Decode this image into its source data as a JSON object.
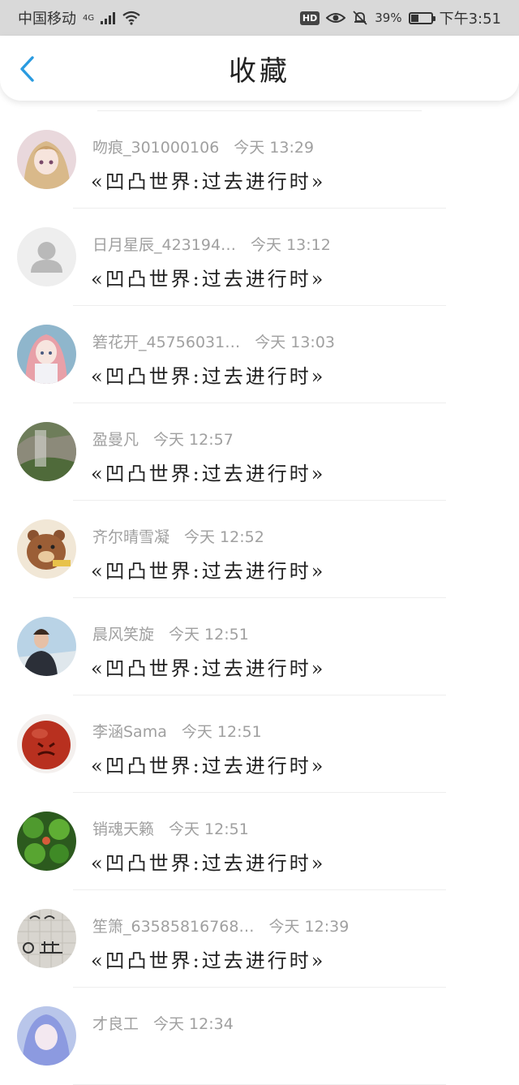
{
  "status_bar": {
    "carrier": "中国移动",
    "network": "4G",
    "hd": "HD",
    "battery_percent": "39%",
    "battery_level": 0.39,
    "time": "下午3:51"
  },
  "header": {
    "title": "收藏",
    "back_icon": "chevron-left-icon"
  },
  "list": {
    "items": [
      {
        "user": "吻痕_301000106",
        "time": "今天 13:29",
        "title": "«凹凸世界:过去进行时»",
        "avatar": "anime-girl-blonde"
      },
      {
        "user": "日月星辰_423194…",
        "time": "今天 13:12",
        "title": "«凹凸世界:过去进行时»",
        "avatar": "default-user"
      },
      {
        "user": "箬花开_45756031…",
        "time": "今天 13:03",
        "title": "«凹凸世界:过去进行时»",
        "avatar": "anime-girl-pink"
      },
      {
        "user": "盈曼凡",
        "time": "今天 12:57",
        "title": "«凹凸世界:过去进行时»",
        "avatar": "rock-landscape"
      },
      {
        "user": "齐尔晴雪凝",
        "time": "今天 12:52",
        "title": "«凹凸世界:过去进行时»",
        "avatar": "cartoon-bear"
      },
      {
        "user": "晨风笑旋",
        "time": "今天 12:51",
        "title": "«凹凸世界:过去进行时»",
        "avatar": "man-photo"
      },
      {
        "user": "李涵Sama",
        "time": "今天 12:51",
        "title": "«凹凸世界:过去进行时»",
        "avatar": "red-ball"
      },
      {
        "user": "销魂天籁",
        "time": "今天 12:51",
        "title": "«凹凸世界:过去进行时»",
        "avatar": "clover-leaves"
      },
      {
        "user": "笙箫_63585816768…",
        "time": "今天 12:39",
        "title": "«凹凸世界:过去进行时»",
        "avatar": "handwriting"
      },
      {
        "user": "才良工",
        "time": "今天 12:34",
        "title": "",
        "avatar": "anime-blue"
      }
    ]
  },
  "colors": {
    "accent": "#2a9be0",
    "status_bar_bg": "#d9d9d9",
    "meta_text": "#a0a0a0",
    "title_text": "#222222"
  }
}
